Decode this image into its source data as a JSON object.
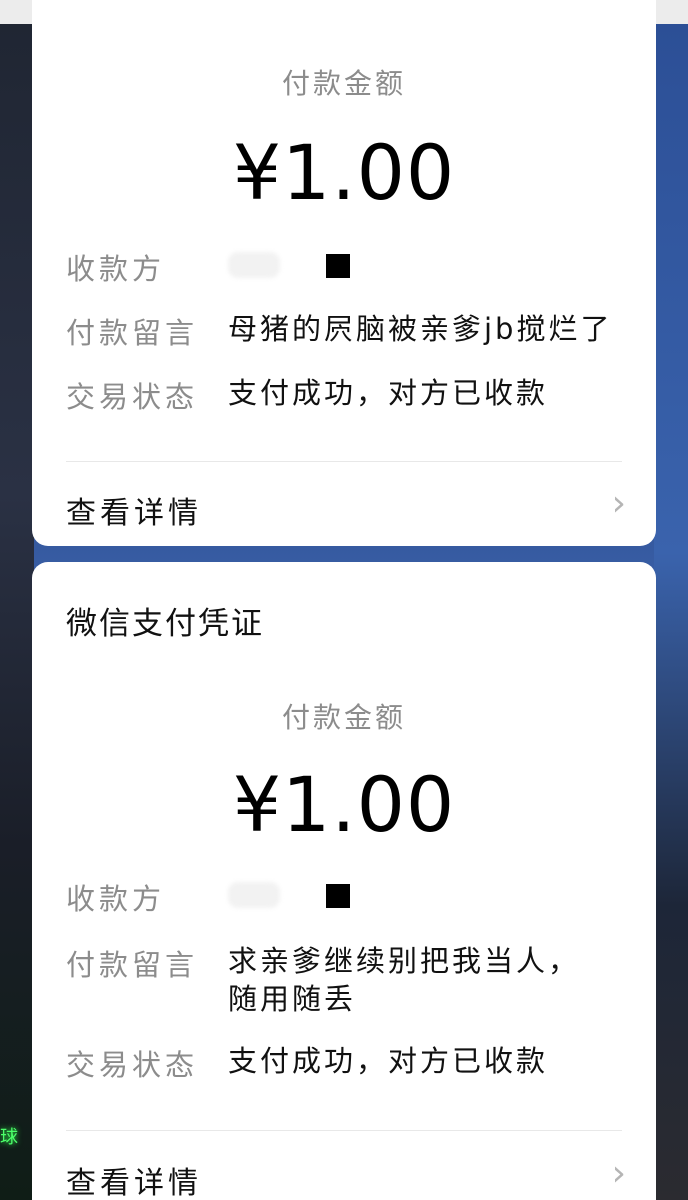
{
  "cards": [
    {
      "title": "",
      "amount_label": "付款金额",
      "amount": "¥1.00",
      "payee_label": "收款方",
      "message_label": "付款留言",
      "message": "母猪的屄脑被亲爹jb搅烂了",
      "status_label": "交易状态",
      "status": "支付成功，对方已收款",
      "details_label": "查看详情"
    },
    {
      "title": "微信支付凭证",
      "amount_label": "付款金额",
      "amount": "¥1.00",
      "payee_label": "收款方",
      "message_label": "付款留言",
      "message": "求亲爹继续别把我当人，随用随丢",
      "status_label": "交易状态",
      "status": "支付成功，对方已收款",
      "details_label": "查看详情"
    }
  ],
  "background_sign_text": "球",
  "icons": {
    "chevron": "chevron-right-icon"
  },
  "colors": {
    "card": "#ffffff",
    "label": "#8c8c8c",
    "text": "#111111",
    "chevron": "#b5b5b5"
  }
}
